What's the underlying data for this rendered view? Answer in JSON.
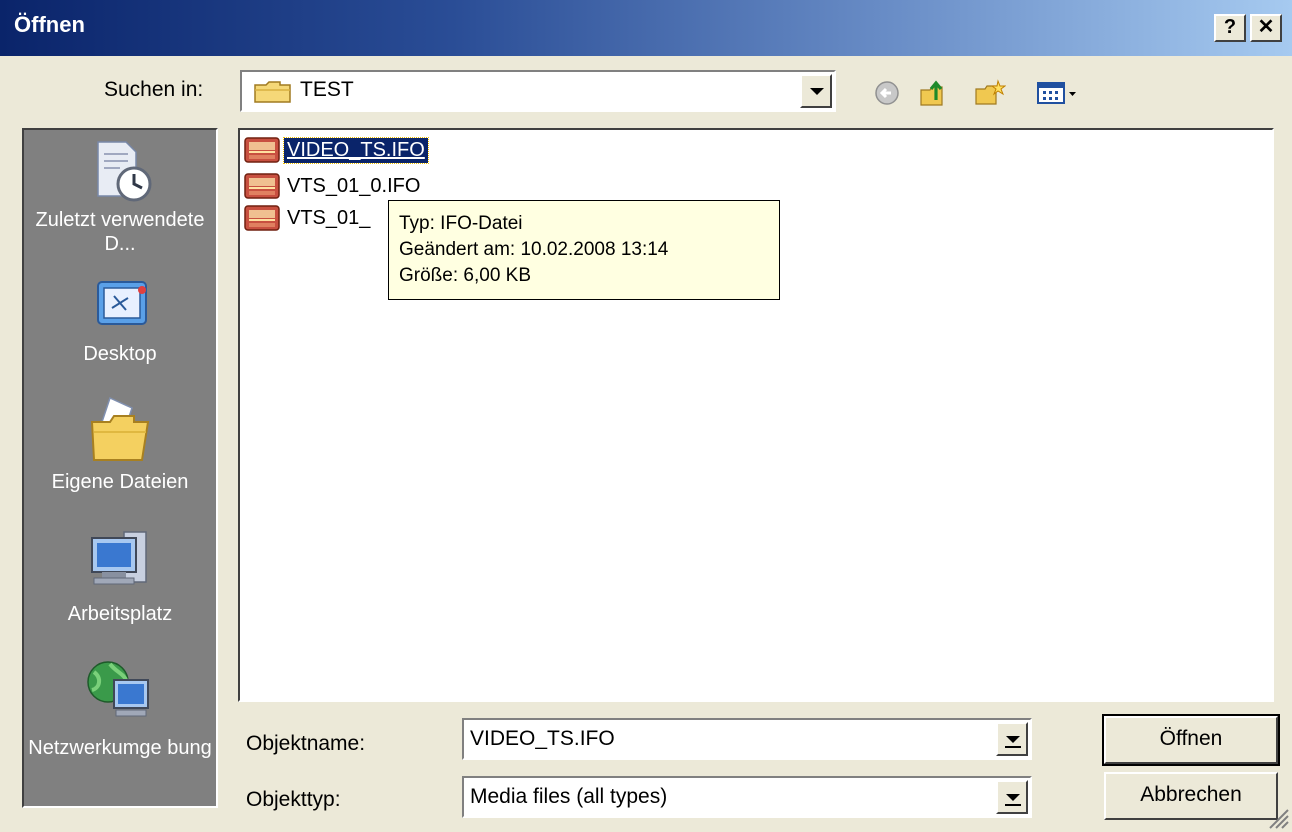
{
  "window": {
    "title": "Öffnen",
    "help_label": "?",
    "close_label": "✕"
  },
  "lookin": {
    "label": "Suchen in:",
    "value": "TEST"
  },
  "toolbar": {
    "icons": [
      "back-icon",
      "up-folder-icon",
      "new-folder-icon",
      "views-menu-icon"
    ]
  },
  "places": [
    {
      "label": "Zuletzt verwendete D...",
      "icon": "recent-documents-icon"
    },
    {
      "label": "Desktop",
      "icon": "desktop-icon"
    },
    {
      "label": "Eigene Dateien",
      "icon": "my-documents-icon"
    },
    {
      "label": "Arbeitsplatz",
      "icon": "my-computer-icon"
    },
    {
      "label": "Netzwerkumge bung",
      "icon": "network-icon"
    }
  ],
  "files": [
    {
      "name": "VIDEO_TS.IFO",
      "selected": true
    },
    {
      "name": "VTS_01_0.IFO",
      "selected": false
    },
    {
      "name": "VTS_01_",
      "selected": false
    }
  ],
  "tooltip": {
    "type": "Typ: IFO-Datei",
    "modified": "Geändert am: 10.02.2008 13:14",
    "size": "Größe: 6,00 KB"
  },
  "filename": {
    "label": "Objektname:",
    "value": "VIDEO_TS.IFO"
  },
  "filetype": {
    "label": "Objekttyp:",
    "value": "Media files (all types)"
  },
  "buttons": {
    "open": "Öffnen",
    "cancel": "Abbrechen"
  },
  "colors": {
    "titlebar_start": "#0a246a",
    "titlebar_end": "#a6caf0",
    "selection": "#0a246a",
    "tooltip_bg": "#ffffe1"
  }
}
